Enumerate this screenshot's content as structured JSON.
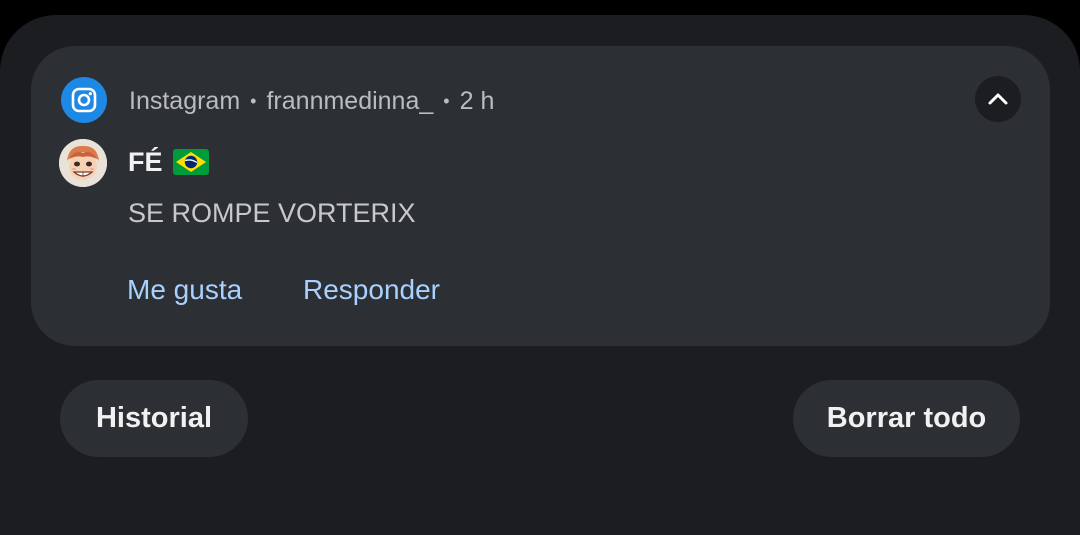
{
  "notification": {
    "app_name": "Instagram",
    "sender": "frannmedinna_",
    "time": "2 h",
    "separator": "•",
    "app_icon": "instagram-icon",
    "title": "FÉ",
    "title_emoji": "brazil-flag",
    "message": "SE ROMPE VORTERIX",
    "actions": [
      "Me gusta",
      "Responder"
    ],
    "collapse_icon": "chevron-up-icon"
  },
  "footer": {
    "history_label": "Historial",
    "clear_label": "Borrar todo"
  },
  "colors": {
    "shade_bg": "#1b1d20",
    "card_bg": "#2c2f33",
    "accent_blue": "#1e88e5",
    "action_text": "#a8d1ff"
  }
}
